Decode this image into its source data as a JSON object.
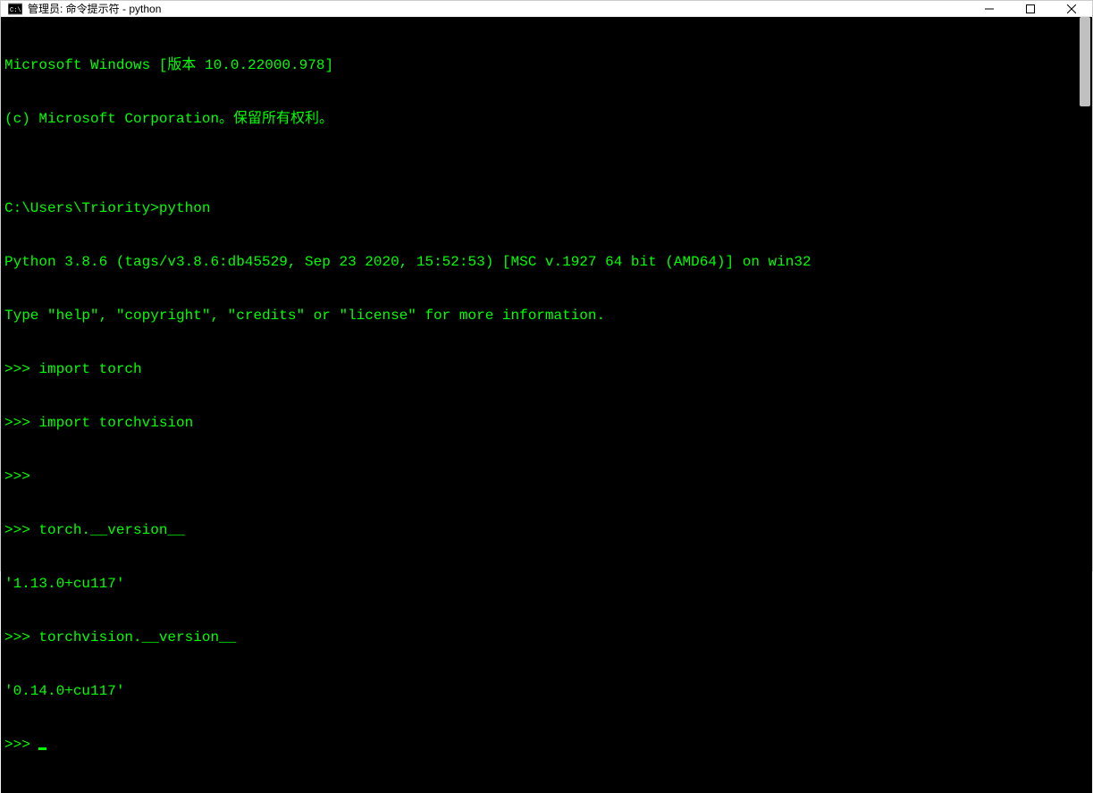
{
  "window": {
    "title": "管理员: 命令提示符 - python"
  },
  "terminal": {
    "lines": [
      "Microsoft Windows [版本 10.0.22000.978]",
      "(c) Microsoft Corporation。保留所有权利。",
      "",
      "C:\\Users\\Triority>python",
      "Python 3.8.6 (tags/v3.8.6:db45529, Sep 23 2020, 15:52:53) [MSC v.1927 64 bit (AMD64)] on win32",
      "Type \"help\", \"copyright\", \"credits\" or \"license\" for more information.",
      ">>> import torch",
      ">>> import torchvision",
      ">>>",
      ">>> torch.__version__",
      "'1.13.0+cu117'",
      ">>> torchvision.__version__",
      "'0.14.0+cu117'",
      ">>> "
    ]
  }
}
